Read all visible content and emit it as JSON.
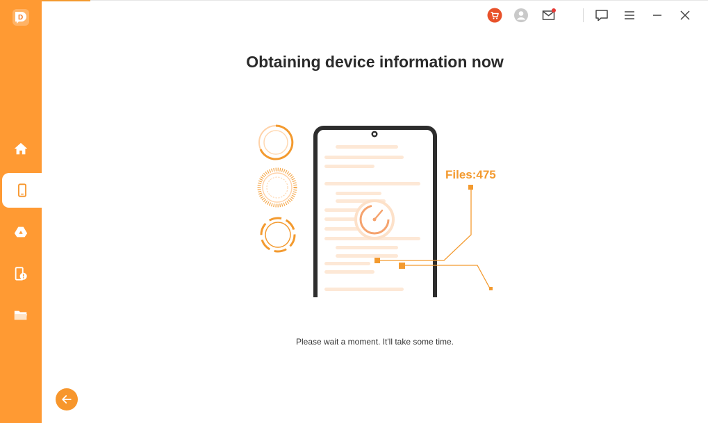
{
  "app": {
    "logo_letter": "D"
  },
  "sidebar": {
    "items": [
      {
        "name": "home",
        "icon": "home-icon",
        "active": false
      },
      {
        "name": "device",
        "icon": "phone-icon",
        "active": true
      },
      {
        "name": "cloud",
        "icon": "drive-icon",
        "active": false
      },
      {
        "name": "device-alert",
        "icon": "device-alert-icon",
        "active": false
      },
      {
        "name": "folder",
        "icon": "folder-icon",
        "active": false
      }
    ],
    "back_icon": "arrow-left-icon"
  },
  "titlebar": {
    "icons": [
      "cart-icon",
      "user-icon",
      "mail-icon",
      "feedback-icon",
      "menu-icon",
      "minimize-icon",
      "close-icon"
    ]
  },
  "main": {
    "title": "Obtaining device information now",
    "files_label": "Files:475",
    "subtitle": "Please wait a moment. It'll take some time."
  },
  "colors": {
    "accent": "#ff9a33",
    "accent_dark": "#f39a2f",
    "cart_red": "#e8512a",
    "phone_frame": "#2d2d2d"
  }
}
